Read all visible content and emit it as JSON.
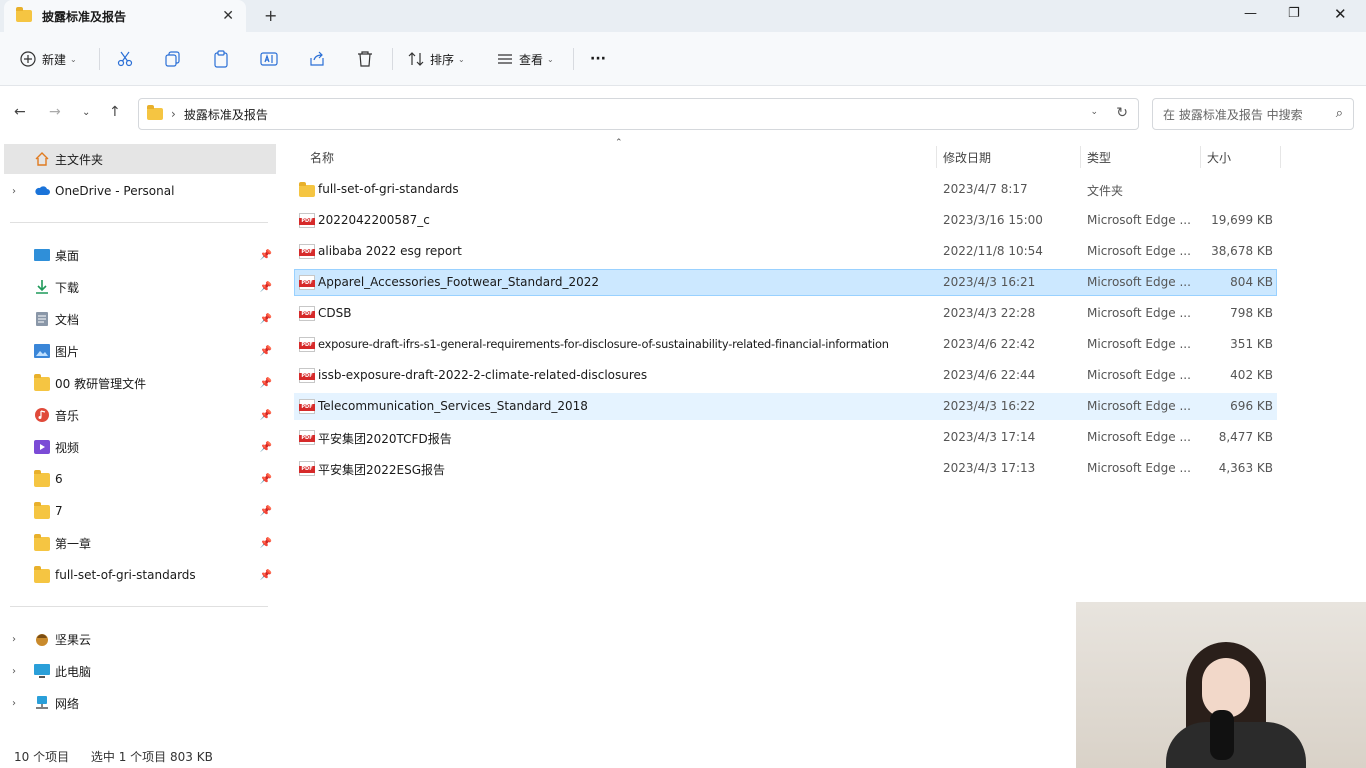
{
  "window": {
    "tab_title": "披露标准及报告",
    "new_tab": "+",
    "close_tab": "✕",
    "minimize": "—",
    "maximize": "❐",
    "close": "✕"
  },
  "toolbar": {
    "new_label": "新建",
    "sort_label": "排序",
    "view_label": "查看",
    "more_label": "···"
  },
  "address": {
    "path": "披露标准及报告",
    "search_placeholder": "在 披露标准及报告 中搜索"
  },
  "sidebar": {
    "home": "主文件夹",
    "onedrive": "OneDrive - Personal",
    "quick": [
      "桌面",
      "下载",
      "文档",
      "图片",
      "00 教研管理文件",
      "音乐",
      "视频",
      "6",
      "7",
      "第一章",
      "full-set-of-gri-standards"
    ],
    "jianguoyun": "坚果云",
    "this_pc": "此电脑",
    "network": "网络"
  },
  "columns": {
    "name": "名称",
    "date": "修改日期",
    "type": "类型",
    "size": "大小"
  },
  "files": [
    {
      "name": "full-set-of-gri-standards",
      "date": "2023/4/7 8:17",
      "type": "文件夹",
      "size": "",
      "kind": "folder"
    },
    {
      "name": "2022042200587_c",
      "date": "2023/3/16 15:00",
      "type": "Microsoft Edge ...",
      "size": "19,699 KB",
      "kind": "pdf"
    },
    {
      "name": "alibaba 2022 esg report",
      "date": "2022/11/8 10:54",
      "type": "Microsoft Edge ...",
      "size": "38,678 KB",
      "kind": "pdf"
    },
    {
      "name": "Apparel_Accessories_Footwear_Standard_2022",
      "date": "2023/4/3 16:21",
      "type": "Microsoft Edge ...",
      "size": "804 KB",
      "kind": "pdf"
    },
    {
      "name": "CDSB",
      "date": "2023/4/3 22:28",
      "type": "Microsoft Edge ...",
      "size": "798 KB",
      "kind": "pdf"
    },
    {
      "name": "exposure-draft-ifrs-s1-general-requirements-for-disclosure-of-sustainability-related-financial-information",
      "date": "2023/4/6 22:42",
      "type": "Microsoft Edge ...",
      "size": "351 KB",
      "kind": "pdf"
    },
    {
      "name": "issb-exposure-draft-2022-2-climate-related-disclosures",
      "date": "2023/4/6 22:44",
      "type": "Microsoft Edge ...",
      "size": "402 KB",
      "kind": "pdf"
    },
    {
      "name": "Telecommunication_Services_Standard_2018",
      "date": "2023/4/3 16:22",
      "type": "Microsoft Edge ...",
      "size": "696 KB",
      "kind": "pdf"
    },
    {
      "name": "平安集团2020TCFD报告",
      "date": "2023/4/3 17:14",
      "type": "Microsoft Edge ...",
      "size": "8,477 KB",
      "kind": "pdf"
    },
    {
      "name": "平安集团2022ESG报告",
      "date": "2023/4/3 17:13",
      "type": "Microsoft Edge ...",
      "size": "4,363 KB",
      "kind": "pdf"
    }
  ],
  "status": {
    "count": "10 个项目",
    "selection": "选中 1 个项目  803 KB"
  },
  "colors": {
    "selected_bg": "#cce8ff",
    "hover_bg": "#e5f3ff",
    "folder": "#f5c542",
    "pdf": "#d62a2a"
  }
}
